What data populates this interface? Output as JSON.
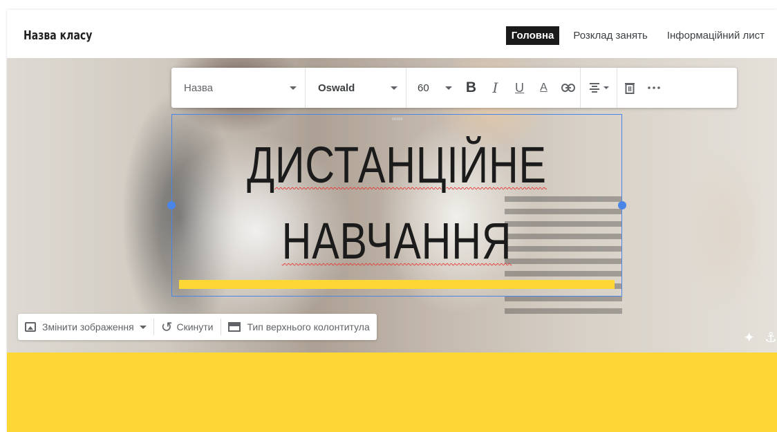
{
  "site": {
    "title": "Назва класу",
    "nav": [
      {
        "label": "Головна",
        "active": true
      },
      {
        "label": "Розклад занять",
        "active": false
      },
      {
        "label": "Інформаційний лист",
        "active": false
      }
    ]
  },
  "text_toolbar": {
    "style_value": "Назва",
    "font_value": "Oswald",
    "size_value": "60",
    "buttons": {
      "bold": "B",
      "italic": "I",
      "underline": "U",
      "text_color": "A",
      "link": "link-icon",
      "align": "align-center-icon",
      "delete": "trash-icon",
      "more": "more-horizontal-icon"
    }
  },
  "hero": {
    "title_line1": "ДИСТАНЦІЙНЕ",
    "title_line2": "НАВЧАННЯ",
    "accent_color": "#fdd835"
  },
  "edit_toolbar": {
    "change_image": "Змінити зображення",
    "reset": "Скинути",
    "header_type": "Тип верхнього колонтитула"
  },
  "corner_icons": [
    "sparkle-icon",
    "anchor-icon"
  ],
  "theme": {
    "selection_color": "#4a86e8",
    "band_color": "#fdd835"
  }
}
